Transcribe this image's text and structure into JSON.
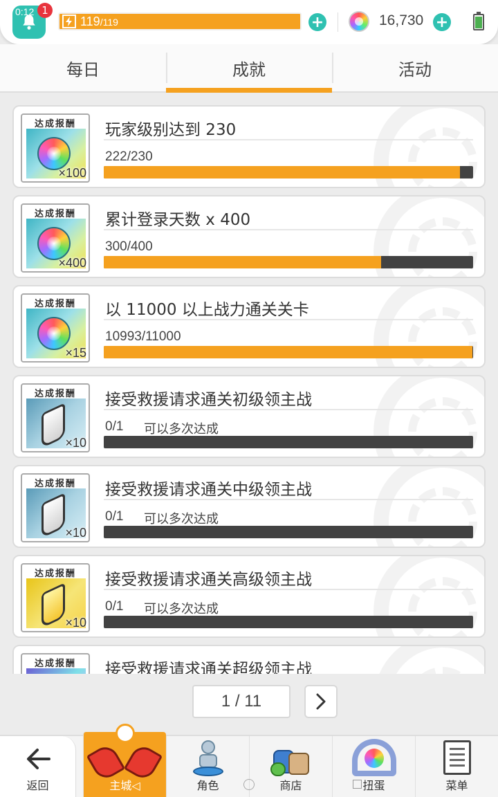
{
  "status": {
    "clock": "0:12",
    "notification_count": "1",
    "stamina_current": "119",
    "stamina_max": "/119",
    "gems": "16,730"
  },
  "tabs": [
    {
      "label": "每日",
      "active": false
    },
    {
      "label": "成就",
      "active": true
    },
    {
      "label": "活动",
      "active": false
    }
  ],
  "reward_label": "达成报酬",
  "achievements": [
    {
      "title": "玩家级别达到 230",
      "progress": "222/230",
      "note": "",
      "fill": 0.965,
      "reward": "gem",
      "qty": "×100"
    },
    {
      "title": "累计登录天数  x 400",
      "progress": "300/400",
      "note": "",
      "fill": 0.75,
      "reward": "gem",
      "qty": "×400"
    },
    {
      "title": "以 11000 以上战力通关关卡",
      "progress": "10993/11000",
      "note": "",
      "fill": 0.998,
      "reward": "gem",
      "qty": "×15"
    },
    {
      "title": "接受救援请求通关初级领主战",
      "progress": "0/1",
      "note": "可以多次达成",
      "fill": 0,
      "reward": "silver",
      "qty": "×10"
    },
    {
      "title": "接受救援请求通关中级领主战",
      "progress": "0/1",
      "note": "可以多次达成",
      "fill": 0,
      "reward": "silver",
      "qty": "×10"
    },
    {
      "title": "接受救援请求通关高级领主战",
      "progress": "0/1",
      "note": "可以多次达成",
      "fill": 0,
      "reward": "gold",
      "qty": "×10"
    },
    {
      "title": "接受救援请求通关超级领主战",
      "progress": "",
      "note": "",
      "fill": 0,
      "reward": "rainbow",
      "qty": ""
    }
  ],
  "pager": {
    "text": "1 / 11"
  },
  "nav": {
    "back": "返回",
    "home": "主城◁",
    "character": "角色",
    "shop": "商店",
    "gacha": "扭蛋",
    "menu": "菜单"
  },
  "colors": {
    "accent": "#f5a11f",
    "teal": "#2fc1b1",
    "bar_bg": "#424242"
  }
}
